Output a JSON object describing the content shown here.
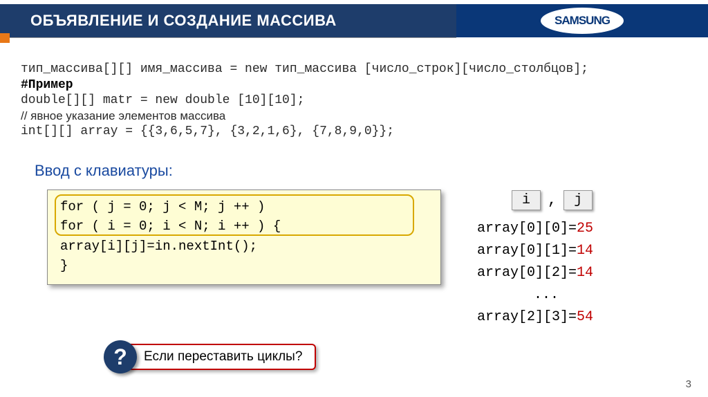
{
  "header": {
    "title": "ОБЪЯВЛЕНИЕ И СОЗДАНИЕ МАССИВА",
    "logo": "SAMSUNG"
  },
  "syntax_line": "тип_массива[][] имя_массива = new тип_массива [число_строк][число_столбцов];",
  "example_label": "#Пример",
  "example_code": "double[][] matr = new double [10][10];",
  "comment_line": "// явное указание элементов массива",
  "array_literal": "int[][] array = {{3,6,5,7}, {3,2,1,6}, {7,8,9,0}};",
  "section_title": "Ввод с клавиатуры:",
  "code_block": {
    "l1": "for ( j = 0; j < M; j ++ )",
    "l2": "  for ( i = 0; i < N; i ++ ) {",
    "l3": "      array[i][j]=in.nextInt();",
    "l4": "    }"
  },
  "ij": {
    "i": "i",
    "comma": ",",
    "j": "j"
  },
  "output": {
    "rows": [
      {
        "prefix": "array[0][0]=",
        "value": "25"
      },
      {
        "prefix": "array[0][1]=",
        "value": "14"
      },
      {
        "prefix": "array[0][2]=",
        "value": "14"
      }
    ],
    "dots": "...",
    "last": {
      "prefix": "array[2][3]=",
      "value": "54"
    }
  },
  "question": {
    "mark": "?",
    "text": "Если переставить циклы?"
  },
  "page": "3"
}
